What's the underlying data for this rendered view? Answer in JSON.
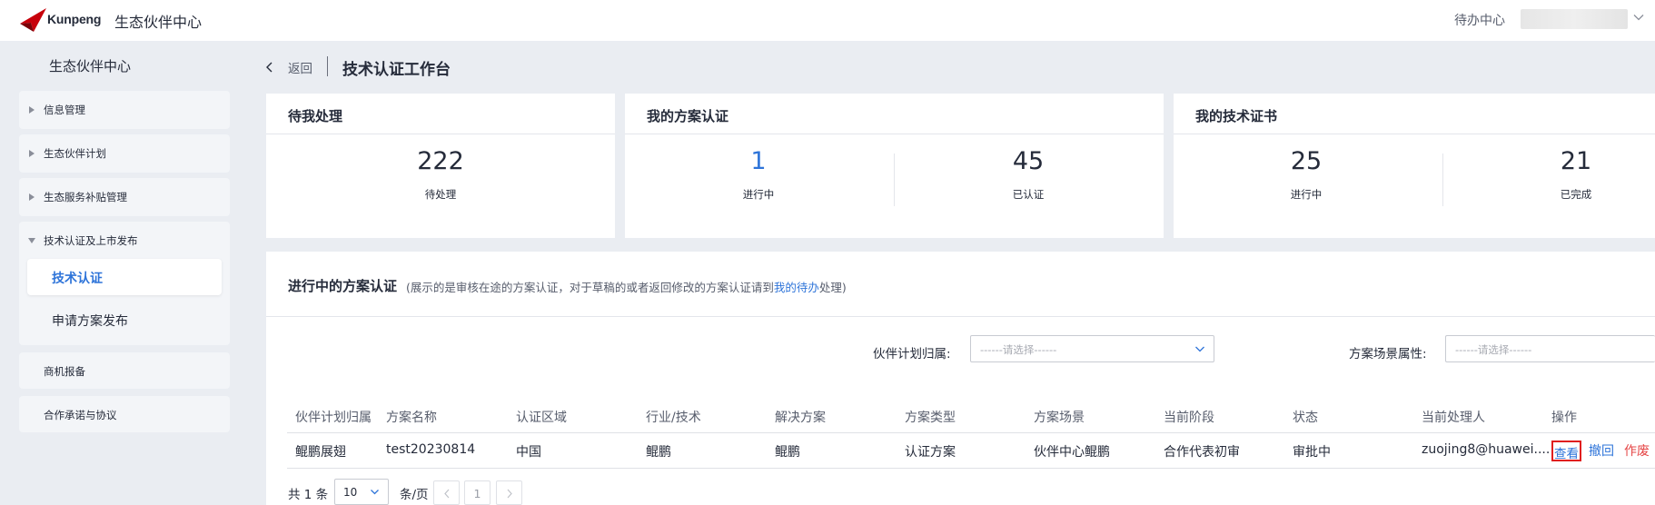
{
  "header": {
    "brand": "Kunpeng",
    "site_title": "生态伙伴中心",
    "todo_center": "待办中心",
    "brand_color": "#c7000b"
  },
  "sidebar": {
    "title": "生态伙伴中心",
    "items": [
      {
        "label": "信息管理",
        "expanded": false
      },
      {
        "label": "生态伙伴计划",
        "expanded": false
      },
      {
        "label": "生态服务补贴管理",
        "expanded": false
      },
      {
        "label": "技术认证及上市发布",
        "expanded": true,
        "children": [
          {
            "label": "技术认证",
            "active": true
          },
          {
            "label": "申请方案发布",
            "active": false
          }
        ]
      },
      {
        "label": "商机报备"
      },
      {
        "label": "合作承诺与协议"
      }
    ]
  },
  "breadcrumb": {
    "back": "返回",
    "title": "技术认证工作台"
  },
  "cards": {
    "pending": {
      "title": "待我处理",
      "value": "222",
      "label": "待处理"
    },
    "solution": {
      "title": "我的方案认证",
      "in_progress_value": "1",
      "in_progress_label": "进行中",
      "certified_value": "45",
      "certified_label": "已认证"
    },
    "certificate": {
      "title": "我的技术证书",
      "in_progress_value": "25",
      "in_progress_label": "进行中",
      "done_value": "21",
      "done_label": "已完成"
    }
  },
  "panel": {
    "title": "进行中的方案认证",
    "note_prefix": "(展示的是审核在途的方案认证，对于草稿的或者返回修改的方案认证请到",
    "note_link": "我的待办",
    "note_suffix": "处理)",
    "filters": {
      "partner_plan_label": "伙伴计划归属:",
      "partner_plan_placeholder": "------请选择------",
      "scenario_label": "方案场景属性:",
      "scenario_placeholder": "------请选择------"
    },
    "table": {
      "headers": [
        "伙伴计划归属",
        "方案名称",
        "认证区域",
        "行业/技术",
        "解决方案",
        "方案类型",
        "方案场景",
        "当前阶段",
        "状态",
        "当前处理人",
        "操作"
      ],
      "rows": [
        {
          "cells": [
            "鲲鹏展翅",
            "test20230814",
            "中国",
            "鲲鹏",
            "鲲鹏",
            "认证方案",
            "伙伴中心鲲鹏",
            "合作代表初审",
            "审批中",
            "zuojing8@huawei...."
          ],
          "actions": {
            "view": "查看",
            "revoke": "撤回",
            "void": "作废"
          }
        }
      ]
    },
    "pagination": {
      "total": "共 1 条",
      "page_size": "10",
      "unit": "条/页",
      "current_page": "1"
    }
  },
  "colors": {
    "accent": "#2e74d9",
    "danger": "#e54545",
    "page_bg": "#eaedf2"
  }
}
